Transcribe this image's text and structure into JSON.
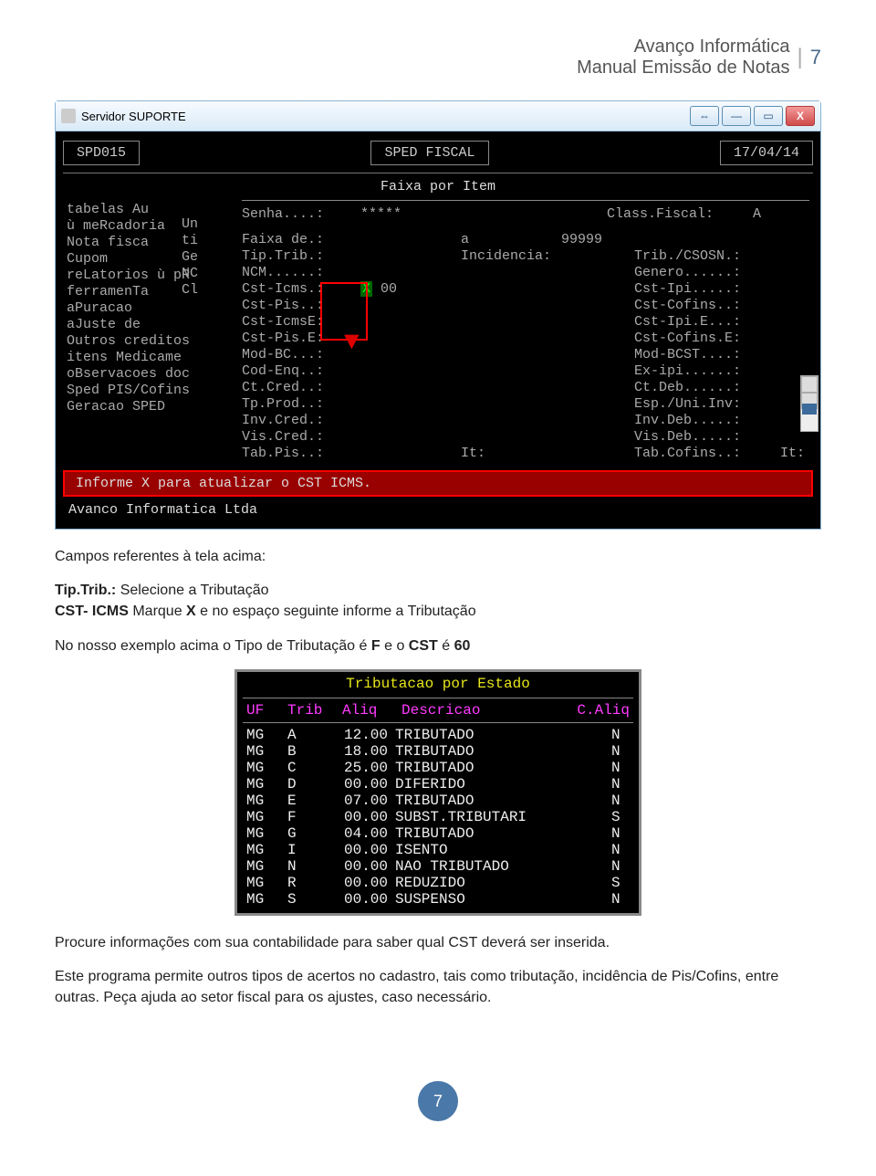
{
  "doc": {
    "company": "Avanço Informática",
    "subtitle": "Manual Emissão de Notas",
    "page_number": "7"
  },
  "window": {
    "title": "Servidor SUPORTE",
    "btn_min": "—",
    "btn_max": "▭",
    "btn_close": "X",
    "btn_extra": "⇔"
  },
  "dos": {
    "code": "SPD015",
    "name": "SPED FISCAL",
    "date": "17/04/14",
    "screen_title": "Faixa por Item",
    "menu": [
      "tabelas Au",
      "ù meRcadoria",
      "Nota fisca",
      "Cupom",
      "reLatorios  ù pR",
      "ferramenTa",
      "aPuracao",
      "aJuste de",
      "Outros creditos",
      "itens   Medicame",
      "oBservacoes doc",
      "Sped PIS/Cofins",
      "Geracao SPED"
    ],
    "sub": [
      "Un",
      "ti",
      "Ge",
      "",
      "NC",
      "Cl"
    ],
    "form": {
      "senha_label": "Senha....:",
      "senha_value": "*****",
      "class_label": "Class.Fiscal:",
      "class_value": "A",
      "rows": [
        {
          "l": "Faixa de.:",
          "v": "",
          "mid": "a",
          "r": "99999",
          "r2": "",
          "rv": ""
        },
        {
          "l": "Tip.Trib.:",
          "v": "",
          "mid": "Incidencia:",
          "r": "",
          "r2": "Trib./CSOSN.:",
          "rv": ""
        },
        {
          "l": "NCM......:",
          "v": "",
          "mid": "",
          "r": "",
          "r2": "Genero......:",
          "rv": ""
        },
        {
          "l": "Cst-Icms.:",
          "v": "X 00",
          "mid": "",
          "r": "",
          "r2": "Cst-Ipi.....:",
          "rv": ""
        },
        {
          "l": "Cst-Pis..:",
          "v": "",
          "mid": "",
          "r": "",
          "r2": "Cst-Cofins..:",
          "rv": ""
        },
        {
          "l": "Cst-IcmsE:",
          "v": "",
          "mid": "",
          "r": "",
          "r2": "Cst-Ipi.E...:",
          "rv": ""
        },
        {
          "l": "Cst-Pis.E:",
          "v": "",
          "mid": "",
          "r": "",
          "r2": "Cst-Cofins.E:",
          "rv": ""
        },
        {
          "l": "Mod-BC...:",
          "v": "",
          "mid": "",
          "r": "",
          "r2": "Mod-BCST....:",
          "rv": ""
        },
        {
          "l": "Cod-Enq..:",
          "v": "",
          "mid": "",
          "r": "",
          "r2": "Ex-ipi......:",
          "rv": ""
        },
        {
          "l": "Ct.Cred..:",
          "v": "",
          "mid": "",
          "r": "",
          "r2": "Ct.Deb......:",
          "rv": ""
        },
        {
          "l": "Tp.Prod..:",
          "v": "",
          "mid": "",
          "r": "",
          "r2": "Esp./Uni.Inv:",
          "rv": ""
        },
        {
          "l": "Inv.Cred.:",
          "v": "",
          "mid": "",
          "r": "",
          "r2": "Inv.Deb.....:",
          "rv": ""
        },
        {
          "l": "Vis.Cred.:",
          "v": "",
          "mid": "",
          "r": "",
          "r2": "Vis.Deb.....:",
          "rv": ""
        },
        {
          "l": "Tab.Pis..:",
          "v": "",
          "mid": "It:",
          "r": "",
          "r2": "Tab.Cofins..:",
          "rv": "It:"
        }
      ]
    },
    "hint": "Informe X para atualizar o CST ICMS.",
    "footer": "Avanco Informatica Ltda"
  },
  "text": {
    "heading": "Campos referentes à tela acima:",
    "p1a": "Tip.Trib.:",
    "p1b": " Selecione a Tributação",
    "p2a": "CST- ICMS",
    "p2b": " Marque ",
    "p2c": "X",
    "p2d": " e no espaço seguinte informe a Tributação",
    "p3a": "No nosso exemplo acima o Tipo de Tributação é ",
    "p3b": "F",
    "p3c": " e o ",
    "p3d": "CST",
    "p3e": " é ",
    "p3f": "60",
    "p4": "Procure informações com sua contabilidade para saber qual CST deverá ser inserida.",
    "p5": "Este programa permite outros tipos de acertos no cadastro, tais como tributação, incidência de Pis/Cofins, entre outras. Peça ajuda ao setor fiscal para os ajustes, caso necessário."
  },
  "trib": {
    "title": "Tributacao por Estado",
    "headers": [
      "UF",
      "Trib",
      "Aliq",
      "Descricao",
      "C.Aliq"
    ],
    "rows": [
      {
        "uf": "MG",
        "t": "A",
        "aliq": "12.00",
        "desc": "TRIBUTADO",
        "c": "N"
      },
      {
        "uf": "MG",
        "t": "B",
        "aliq": "18.00",
        "desc": "TRIBUTADO",
        "c": "N"
      },
      {
        "uf": "MG",
        "t": "C",
        "aliq": "25.00",
        "desc": "TRIBUTADO",
        "c": "N"
      },
      {
        "uf": "MG",
        "t": "D",
        "aliq": "00.00",
        "desc": "DIFERIDO",
        "c": "N"
      },
      {
        "uf": "MG",
        "t": "E",
        "aliq": "07.00",
        "desc": "TRIBUTADO",
        "c": "N"
      },
      {
        "uf": "MG",
        "t": "F",
        "aliq": "00.00",
        "desc": "SUBST.TRIBUTARI",
        "c": "S"
      },
      {
        "uf": "MG",
        "t": "G",
        "aliq": "04.00",
        "desc": "TRIBUTADO",
        "c": "N"
      },
      {
        "uf": "MG",
        "t": "I",
        "aliq": "00.00",
        "desc": "ISENTO",
        "c": "N"
      },
      {
        "uf": "MG",
        "t": "N",
        "aliq": "00.00",
        "desc": "NAO TRIBUTADO",
        "c": "N"
      },
      {
        "uf": "MG",
        "t": "R",
        "aliq": "00.00",
        "desc": "REDUZIDO",
        "c": "S"
      },
      {
        "uf": "MG",
        "t": "S",
        "aliq": "00.00",
        "desc": "SUSPENSO",
        "c": "N"
      }
    ]
  }
}
